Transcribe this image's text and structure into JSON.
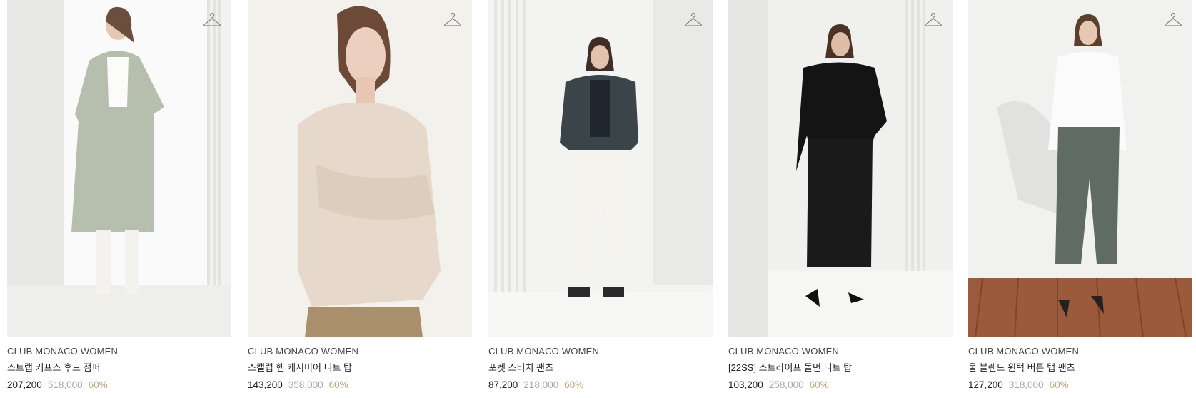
{
  "products": [
    {
      "brand": "CLUB MONACO WOMEN",
      "name": "스트랩 커프스 후드 점퍼",
      "sale_price": "207,200",
      "original_price": "518,000",
      "discount": "60%",
      "image_icon": "model-photo"
    },
    {
      "brand": "CLUB MONACO WOMEN",
      "name": "스캘럽 헴 캐시미어 니트 탑",
      "sale_price": "143,200",
      "original_price": "358,000",
      "discount": "60%",
      "image_icon": "model-photo"
    },
    {
      "brand": "CLUB MONACO WOMEN",
      "name": "포켓 스티치 팬츠",
      "sale_price": "87,200",
      "original_price": "218,000",
      "discount": "60%",
      "image_icon": "model-photo"
    },
    {
      "brand": "CLUB MONACO WOMEN",
      "name": "[22SS] 스트라이프 돌먼 니트 탑",
      "sale_price": "103,200",
      "original_price": "258,000",
      "discount": "60%",
      "image_icon": "model-photo"
    },
    {
      "brand": "CLUB MONACO WOMEN",
      "name": "울 블렌드 윈턱 버튼 탭 팬츠",
      "sale_price": "127,200",
      "original_price": "318,000",
      "discount": "60%",
      "image_icon": "model-photo"
    }
  ],
  "wishlist_icon": "hanger-icon",
  "colors": {
    "text": "#222222",
    "original_price": "#a8a8a8",
    "discount": "#c6a27c"
  }
}
